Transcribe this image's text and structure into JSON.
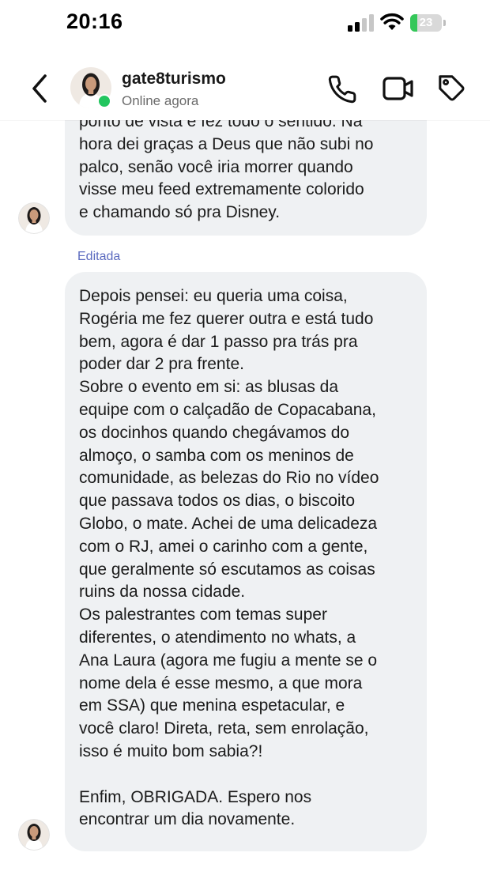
{
  "status_bar": {
    "time": "20:16",
    "battery_level": "23",
    "battery_fraction": 0.23,
    "battery_color": "#34c759"
  },
  "header": {
    "back_icon": "chevron-left-icon",
    "contact_name": "gate8turismo",
    "contact_status": "Online agora",
    "online_color": "#22c55e",
    "actions": [
      "phone-icon",
      "video-camera-icon",
      "tag-icon"
    ]
  },
  "messages": [
    {
      "lines": [
        "ponto de vista e fez todo o sentido. Na",
        "hora dei graças a Deus que não subi no",
        "palco, senão você iria morrer quando",
        "visse meu feed extremamente colorido",
        "e chamando só pra Disney."
      ]
    },
    {
      "edited_label": "Editada",
      "lines": [
        "Depois pensei: eu queria uma coisa,",
        "Rogéria me fez querer outra e está tudo",
        "bem, agora é dar 1 passo pra trás pra",
        "poder dar 2 pra frente.",
        "Sobre o evento em si: as blusas da",
        "equipe com o calçadão de Copacabana,",
        "os docinhos quando chegávamos do",
        "almoço, o samba com os meninos de",
        "comunidade, as belezas do Rio no vídeo",
        "que passava todos os dias, o biscoito",
        "Globo, o mate. Achei de uma delicadeza",
        "com o RJ, amei o carinho com a gente,",
        "que geralmente só escutamos as coisas",
        "ruins da nossa cidade.",
        "Os palestrantes com temas super",
        "diferentes, o atendimento no whats, a",
        "Ana Laura (agora me fugiu a mente se o",
        "nome dela é esse mesmo, a que mora",
        "em SSA) que menina espetacular, e",
        "você claro! Direta, reta, sem enrolação,",
        "isso é muito bom sabia?!",
        "",
        "Enfim, OBRIGADA. Espero nos",
        "encontrar um dia novamente."
      ]
    }
  ],
  "colors": {
    "bubble": "#eff1f3",
    "edited_label": "#5b6abf"
  }
}
